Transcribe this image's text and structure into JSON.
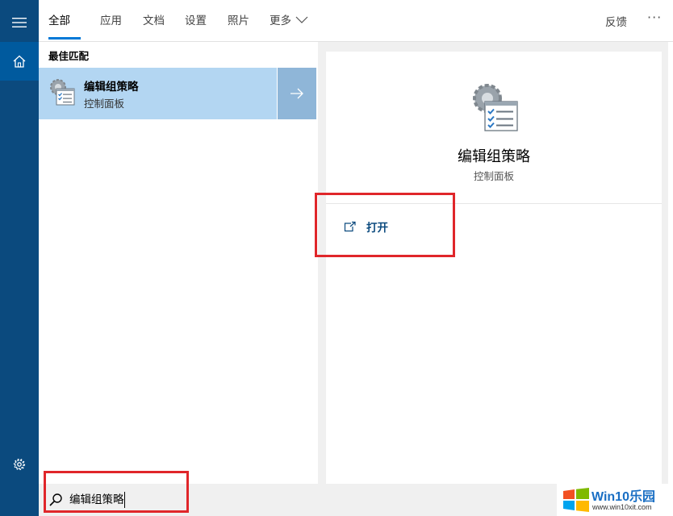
{
  "tabs": [
    {
      "label": "全部",
      "active": true
    },
    {
      "label": "应用",
      "active": false
    },
    {
      "label": "文档",
      "active": false
    },
    {
      "label": "设置",
      "active": false
    },
    {
      "label": "照片",
      "active": false
    },
    {
      "label": "更多",
      "active": false
    }
  ],
  "header": {
    "feedback_label": "反馈",
    "more_options": "···"
  },
  "results": {
    "section_title": "最佳匹配",
    "best_match": {
      "title": "编辑组策略",
      "subtitle": "控制面板",
      "icon": "group-policy-icon"
    }
  },
  "detail": {
    "title": "编辑组策略",
    "subtitle": "控制面板",
    "actions": [
      {
        "label": "打开",
        "icon": "open-external-icon"
      }
    ]
  },
  "search": {
    "value": "编辑组策略"
  },
  "branding": {
    "logo_text": "Win10乐园",
    "logo_url": "www.win10xit.com"
  },
  "colors": {
    "sidebar": "#0b4a7e",
    "accent": "#0078d7",
    "selection": "#b3d6f2",
    "highlight": "#e0262a"
  }
}
